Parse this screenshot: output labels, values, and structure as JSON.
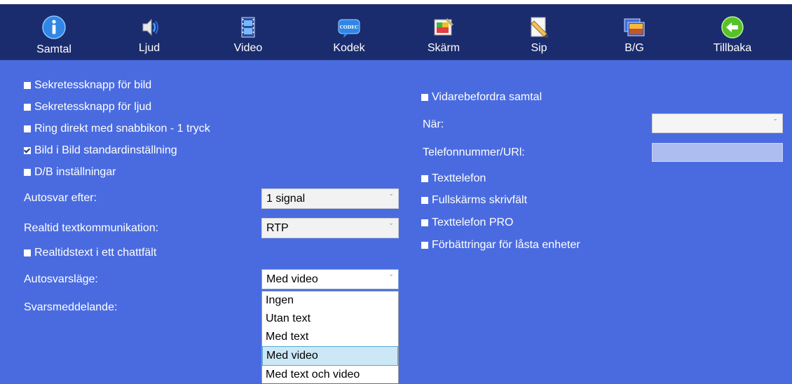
{
  "colors": {
    "topbar": "#1b2c6e",
    "background": "#4a6be0",
    "dropdown_selected": "#cce8f7"
  },
  "nav": {
    "items": [
      {
        "label": "Samtal",
        "icon": "info-icon"
      },
      {
        "label": "Ljud",
        "icon": "speaker-icon"
      },
      {
        "label": "Video",
        "icon": "film-icon"
      },
      {
        "label": "Kodek",
        "icon": "codec-icon"
      },
      {
        "label": "Skärm",
        "icon": "screen-paint-icon"
      },
      {
        "label": "Sip",
        "icon": "pencil-icon"
      },
      {
        "label": "B/G",
        "icon": "image-icon"
      },
      {
        "label": "Tillbaka",
        "icon": "back-arrow-icon"
      }
    ],
    "codec_badge": "CODEC"
  },
  "left": {
    "checkboxes": [
      {
        "label": "Sekretessknapp för bild",
        "checked": false
      },
      {
        "label": "Sekretessknapp för ljud",
        "checked": false
      },
      {
        "label": "Ring direkt med snabbikon - 1 tryck",
        "checked": false
      },
      {
        "label": "Bild i Bild standardinställning",
        "checked": true
      },
      {
        "label": "D/B inställningar",
        "checked": false
      }
    ],
    "autosvar_label": "Autosvar efter:",
    "autosvar_value": "1 signal",
    "realtid_label": "Realtid textkommunikation:",
    "realtid_value": "RTP",
    "chat_checkbox": {
      "label": "Realtidstext i ett chattfält",
      "checked": false
    },
    "autosvarslage_label": "Autosvarsläge:",
    "autosvarslage_value": "Med video",
    "svarsmeddelande_label": "Svarsmeddelande:",
    "dropdown_options": [
      "Ingen",
      "Utan text",
      "Med text",
      "Med video",
      "Med text och video"
    ],
    "dropdown_selected": "Med video"
  },
  "right": {
    "vidare": {
      "label": "Vidarebefordra samtal",
      "checked": false
    },
    "nar_label": "När:",
    "nar_value": "",
    "telefon_label": "Telefonnummer/URl:",
    "telefon_value": "",
    "checkboxes": [
      {
        "label": "Texttelefon",
        "checked": false
      },
      {
        "label": "Fullskärms skrivfält",
        "checked": false
      },
      {
        "label": "Texttelefon PRO",
        "checked": false
      },
      {
        "label": "Förbättringar för låsta enheter",
        "checked": false
      }
    ]
  }
}
